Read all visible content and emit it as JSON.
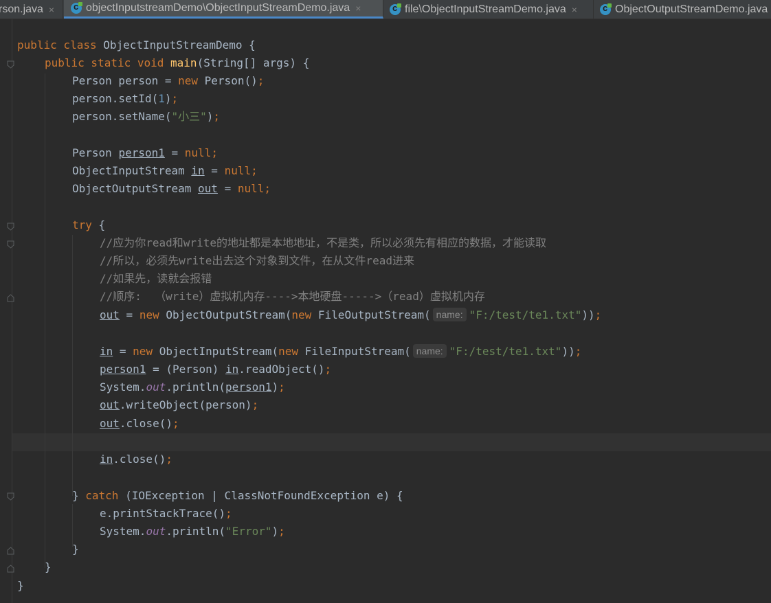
{
  "tabs": [
    {
      "label": "rson.java",
      "active": false,
      "icon": "java-class-icon"
    },
    {
      "label": "objectInputstreamDemo\\ObjectInputStreamDemo.java",
      "active": true,
      "icon": "java-class-icon"
    },
    {
      "label": "file\\ObjectInputStreamDemo.java",
      "active": false,
      "icon": "java-class-icon"
    },
    {
      "label": "ObjectOutputStreamDemo.java",
      "active": false,
      "icon": "java-class-icon"
    }
  ],
  "close_glyph": "×",
  "colors": {
    "background": "#2b2b2b",
    "keyword": "#cc7832",
    "method_declaration": "#ffc66d",
    "number": "#6897bb",
    "string": "#6a8759",
    "comment": "#808080",
    "static_field": "#9876aa",
    "default_text": "#a9b7c6",
    "active_tab_underline": "#4a88c7"
  },
  "code": {
    "l1": {
      "kw1": "public class ",
      "t1": "ObjectInputStreamDemo {"
    },
    "l2": {
      "kw1": "public static void ",
      "fn": "main",
      "t1": "(String[] args) {"
    },
    "l3": {
      "t1": "Person person = ",
      "kw1": "new ",
      "t2": "Person()",
      "p": ";"
    },
    "l4": {
      "t1": "person.setId(",
      "num": "1",
      "t2": ")",
      "p": ";"
    },
    "l5": {
      "t1": "person.setName(",
      "str": "\"小三\"",
      "t2": ")",
      "p": ";"
    },
    "l6": {
      "t1": "Person ",
      "v": "person1",
      "t2": " = ",
      "kw1": "null",
      "p": ";"
    },
    "l7": {
      "t1": "ObjectInputStream ",
      "v": "in",
      "t2": " = ",
      "kw1": "null",
      "p": ";"
    },
    "l8": {
      "t1": "ObjectOutputStream ",
      "v": "out",
      "t2": " = ",
      "kw1": "null",
      "p": ";"
    },
    "l9": {
      "kw1": "try ",
      "t1": "{"
    },
    "c1": "//应为你read和write的地址都是本地地址，不是类，所以必须先有相应的数据，才能读取",
    "c2": "//所以，必须先write出去这个对象到文件，在从文件read进来",
    "c3": "//如果先，读就会报错",
    "c4": "//顺序:  （write）虚拟机内存---->本地硬盘----->（read）虚拟机内存",
    "l14": {
      "v": "out",
      "t1": " = ",
      "kw1": "new ",
      "t2": "ObjectOutputStream(",
      "kw2": "new ",
      "t3": "FileOutputStream(",
      "hint": "name:",
      "str": "\"F:/test/te1.txt\"",
      "t4": "))",
      "p": ";"
    },
    "l16": {
      "v": "in",
      "t1": " = ",
      "kw1": "new ",
      "t2": "ObjectInputStream(",
      "kw2": "new ",
      "t3": "FileInputStream(",
      "hint": "name:",
      "str": "\"F:/test/te1.txt\"",
      "t4": "))",
      "p": ";"
    },
    "l17": {
      "v": "person1",
      "t1": " = (Person) ",
      "v2": "in",
      "t2": ".readObject()",
      "p": ";"
    },
    "l18": {
      "t1": "System.",
      "fld": "out",
      "t2": ".println(",
      "v": "person1",
      "t3": ")",
      "p": ";"
    },
    "l19": {
      "v": "out",
      "t1": ".writeObject(person)",
      "p": ";"
    },
    "l20": {
      "v": "out",
      "t1": ".close()",
      "p": ";"
    },
    "l22": {
      "v": "in",
      "t1": ".close()",
      "p": ";"
    },
    "l24": {
      "t1": "} ",
      "kw1": "catch ",
      "t2": "(IOException | ClassNotFoundException e) {"
    },
    "l25": {
      "t1": "e.printStackTrace()",
      "p": ";"
    },
    "l26": {
      "t1": "System.",
      "fld": "out",
      "t2": ".println(",
      "str": "\"Error\"",
      "t3": ")",
      "p": ";"
    },
    "l27": {
      "t1": "}"
    },
    "l28": {
      "t1": "}"
    },
    "l29": {
      "t1": "}"
    }
  }
}
